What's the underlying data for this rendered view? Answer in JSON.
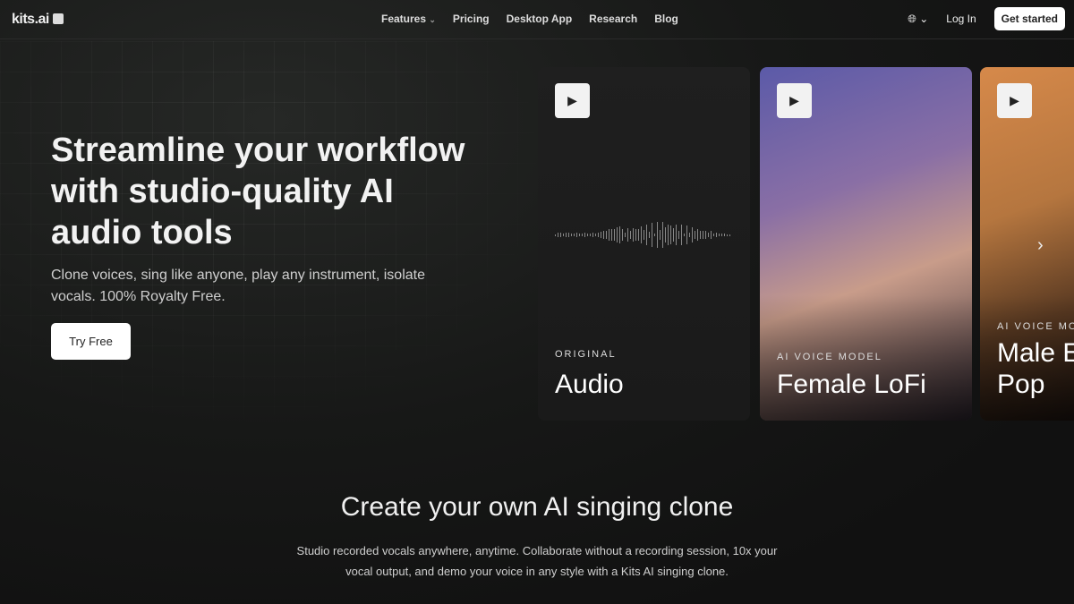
{
  "nav": {
    "logo": "kits.ai",
    "links": [
      "Features",
      "Pricing",
      "Desktop App",
      "Research",
      "Blog"
    ],
    "login": "Log In",
    "cta": "Get started"
  },
  "hero": {
    "title": "Streamline your workflow with studio-quality AI audio tools",
    "subtitle": "Clone voices, sing like anyone, play any instrument, isolate vocals. 100% Royalty Free.",
    "button": "Try Free"
  },
  "cards": [
    {
      "eyebrow": "ORIGINAL",
      "title": "Audio"
    },
    {
      "eyebrow": "AI VOICE MODEL",
      "title": "Female LoFi"
    },
    {
      "eyebrow": "AI VOICE MOD",
      "title": "Male E",
      "title2": "Pop"
    }
  ],
  "section": {
    "title": "Create your own AI singing clone",
    "text": "Studio recorded vocals anywhere, anytime. Collaborate without a recording session, 10x your vocal output, and demo your voice in any style with a Kits AI singing clone."
  }
}
